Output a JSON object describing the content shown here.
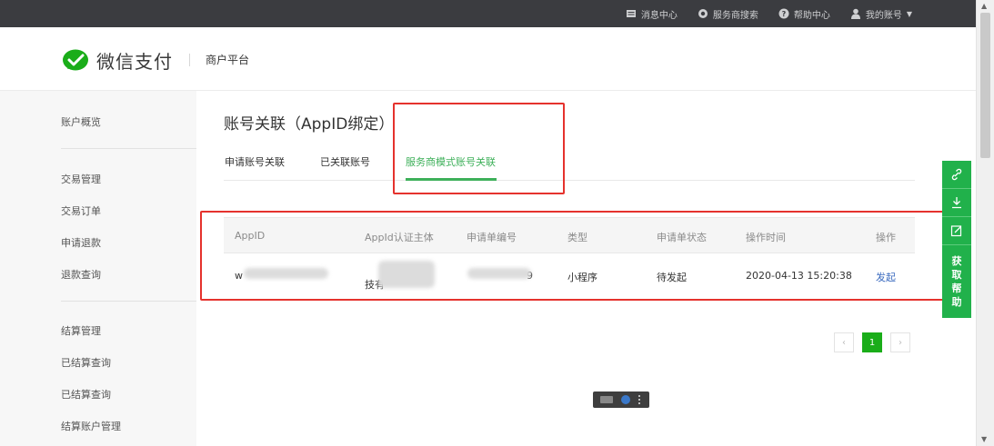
{
  "topbar": {
    "items": [
      {
        "label": "消息中心",
        "icon": "message-icon"
      },
      {
        "label": "服务商搜索",
        "icon": "search-icon"
      },
      {
        "label": "帮助中心",
        "icon": "help-icon"
      },
      {
        "label": "我的账号",
        "icon": "user-icon"
      }
    ]
  },
  "header": {
    "brand": "微信支付",
    "platform": "商户平台",
    "brand_color": "#1aad19"
  },
  "sidebar": {
    "items": [
      "账户概览",
      "交易管理",
      "交易订单",
      "申请退款",
      "退款查询",
      "结算管理",
      "已结算查询",
      "已结算查询",
      "结算账户管理"
    ]
  },
  "main": {
    "title": "账号关联（AppID绑定）",
    "tabs": [
      "申请账号关联",
      "已关联账号",
      "服务商模式账号关联"
    ],
    "active_tab": 2,
    "accent": "#3eb05a"
  },
  "table": {
    "headers": [
      "AppID",
      "AppId认证主体",
      "申请单编号",
      "类型",
      "申请单状态",
      "操作时间",
      "操作"
    ],
    "row": {
      "appid_visible": "w",
      "subject_visible": "技有",
      "order_no_visible": "9",
      "type": "小程序",
      "status": "待发起",
      "time": "2020-04-13 15:20:38",
      "action": "发起"
    }
  },
  "pagination": {
    "prev": "‹",
    "current": "1",
    "next": "›"
  },
  "float_help": {
    "label_chars": [
      "获",
      "取",
      "帮",
      "助"
    ],
    "color": "#21b14b"
  },
  "highlight_color": "#e5322d"
}
